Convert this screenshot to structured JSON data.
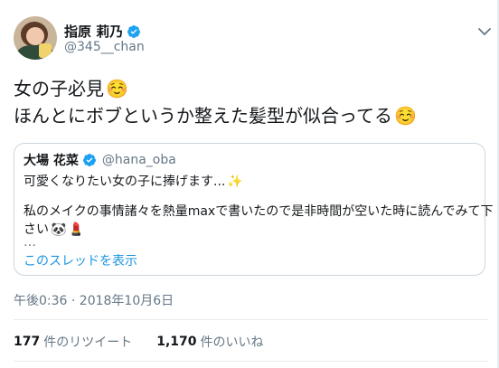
{
  "user": {
    "display_name": "指原 莉乃",
    "handle": "@345__chan"
  },
  "tweet": {
    "line1": "女の子必見",
    "line2": "ほんとにボブというか整えた髪型が似合ってる",
    "emoji": "☺️"
  },
  "quote": {
    "display_name": "大場 花菜",
    "handle": "@hana_oba",
    "line1": "可愛くなりたい女の子に捧げます...",
    "line1_emoji": "✨",
    "body_row1": "私のメイクの事情諸々を熱量maxで書いたので是非時間が空いた時に読んでみて下",
    "body_row2": "さい",
    "body_row2_emoji1": "🐼",
    "body_row2_emoji2": "💄",
    "ellipsis": "…",
    "show_thread": "このスレッドを表示"
  },
  "timestamp": "午後0:36 · 2018年10月6日",
  "stats": {
    "retweets_count": "177",
    "retweets_label": "件のリツイート",
    "likes_count": "1,170",
    "likes_label": "件のいいね"
  },
  "icons": {
    "verified": "verified-badge-icon",
    "menu": "chevron-down-icon"
  },
  "colors": {
    "link": "#1b95e0",
    "secondary_text": "#657786",
    "verified": "#1da1f2"
  }
}
